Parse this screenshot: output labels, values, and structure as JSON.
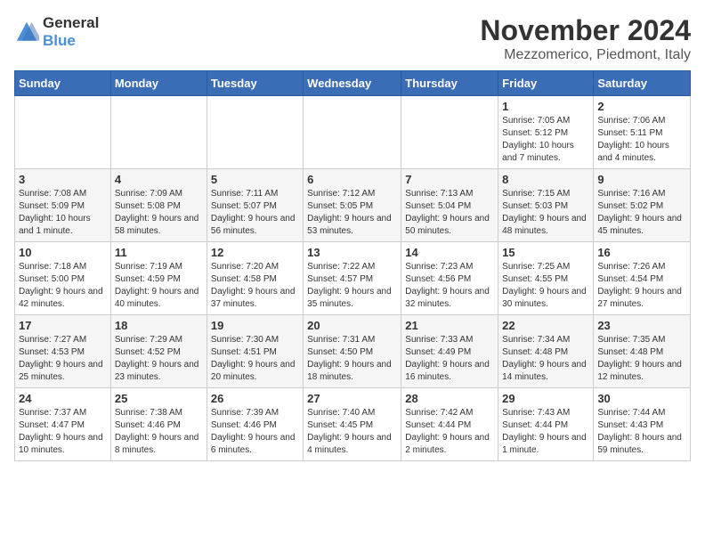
{
  "header": {
    "logo": {
      "general": "General",
      "blue": "Blue"
    },
    "title": "November 2024",
    "location": "Mezzomerico, Piedmont, Italy"
  },
  "calendar": {
    "days_of_week": [
      "Sunday",
      "Monday",
      "Tuesday",
      "Wednesday",
      "Thursday",
      "Friday",
      "Saturday"
    ],
    "weeks": [
      [
        {
          "day": "",
          "info": ""
        },
        {
          "day": "",
          "info": ""
        },
        {
          "day": "",
          "info": ""
        },
        {
          "day": "",
          "info": ""
        },
        {
          "day": "",
          "info": ""
        },
        {
          "day": "1",
          "info": "Sunrise: 7:05 AM\nSunset: 5:12 PM\nDaylight: 10 hours and 7 minutes."
        },
        {
          "day": "2",
          "info": "Sunrise: 7:06 AM\nSunset: 5:11 PM\nDaylight: 10 hours and 4 minutes."
        }
      ],
      [
        {
          "day": "3",
          "info": "Sunrise: 7:08 AM\nSunset: 5:09 PM\nDaylight: 10 hours and 1 minute."
        },
        {
          "day": "4",
          "info": "Sunrise: 7:09 AM\nSunset: 5:08 PM\nDaylight: 9 hours and 58 minutes."
        },
        {
          "day": "5",
          "info": "Sunrise: 7:11 AM\nSunset: 5:07 PM\nDaylight: 9 hours and 56 minutes."
        },
        {
          "day": "6",
          "info": "Sunrise: 7:12 AM\nSunset: 5:05 PM\nDaylight: 9 hours and 53 minutes."
        },
        {
          "day": "7",
          "info": "Sunrise: 7:13 AM\nSunset: 5:04 PM\nDaylight: 9 hours and 50 minutes."
        },
        {
          "day": "8",
          "info": "Sunrise: 7:15 AM\nSunset: 5:03 PM\nDaylight: 9 hours and 48 minutes."
        },
        {
          "day": "9",
          "info": "Sunrise: 7:16 AM\nSunset: 5:02 PM\nDaylight: 9 hours and 45 minutes."
        }
      ],
      [
        {
          "day": "10",
          "info": "Sunrise: 7:18 AM\nSunset: 5:00 PM\nDaylight: 9 hours and 42 minutes."
        },
        {
          "day": "11",
          "info": "Sunrise: 7:19 AM\nSunset: 4:59 PM\nDaylight: 9 hours and 40 minutes."
        },
        {
          "day": "12",
          "info": "Sunrise: 7:20 AM\nSunset: 4:58 PM\nDaylight: 9 hours and 37 minutes."
        },
        {
          "day": "13",
          "info": "Sunrise: 7:22 AM\nSunset: 4:57 PM\nDaylight: 9 hours and 35 minutes."
        },
        {
          "day": "14",
          "info": "Sunrise: 7:23 AM\nSunset: 4:56 PM\nDaylight: 9 hours and 32 minutes."
        },
        {
          "day": "15",
          "info": "Sunrise: 7:25 AM\nSunset: 4:55 PM\nDaylight: 9 hours and 30 minutes."
        },
        {
          "day": "16",
          "info": "Sunrise: 7:26 AM\nSunset: 4:54 PM\nDaylight: 9 hours and 27 minutes."
        }
      ],
      [
        {
          "day": "17",
          "info": "Sunrise: 7:27 AM\nSunset: 4:53 PM\nDaylight: 9 hours and 25 minutes."
        },
        {
          "day": "18",
          "info": "Sunrise: 7:29 AM\nSunset: 4:52 PM\nDaylight: 9 hours and 23 minutes."
        },
        {
          "day": "19",
          "info": "Sunrise: 7:30 AM\nSunset: 4:51 PM\nDaylight: 9 hours and 20 minutes."
        },
        {
          "day": "20",
          "info": "Sunrise: 7:31 AM\nSunset: 4:50 PM\nDaylight: 9 hours and 18 minutes."
        },
        {
          "day": "21",
          "info": "Sunrise: 7:33 AM\nSunset: 4:49 PM\nDaylight: 9 hours and 16 minutes."
        },
        {
          "day": "22",
          "info": "Sunrise: 7:34 AM\nSunset: 4:48 PM\nDaylight: 9 hours and 14 minutes."
        },
        {
          "day": "23",
          "info": "Sunrise: 7:35 AM\nSunset: 4:48 PM\nDaylight: 9 hours and 12 minutes."
        }
      ],
      [
        {
          "day": "24",
          "info": "Sunrise: 7:37 AM\nSunset: 4:47 PM\nDaylight: 9 hours and 10 minutes."
        },
        {
          "day": "25",
          "info": "Sunrise: 7:38 AM\nSunset: 4:46 PM\nDaylight: 9 hours and 8 minutes."
        },
        {
          "day": "26",
          "info": "Sunrise: 7:39 AM\nSunset: 4:46 PM\nDaylight: 9 hours and 6 minutes."
        },
        {
          "day": "27",
          "info": "Sunrise: 7:40 AM\nSunset: 4:45 PM\nDaylight: 9 hours and 4 minutes."
        },
        {
          "day": "28",
          "info": "Sunrise: 7:42 AM\nSunset: 4:44 PM\nDaylight: 9 hours and 2 minutes."
        },
        {
          "day": "29",
          "info": "Sunrise: 7:43 AM\nSunset: 4:44 PM\nDaylight: 9 hours and 1 minute."
        },
        {
          "day": "30",
          "info": "Sunrise: 7:44 AM\nSunset: 4:43 PM\nDaylight: 8 hours and 59 minutes."
        }
      ]
    ]
  }
}
